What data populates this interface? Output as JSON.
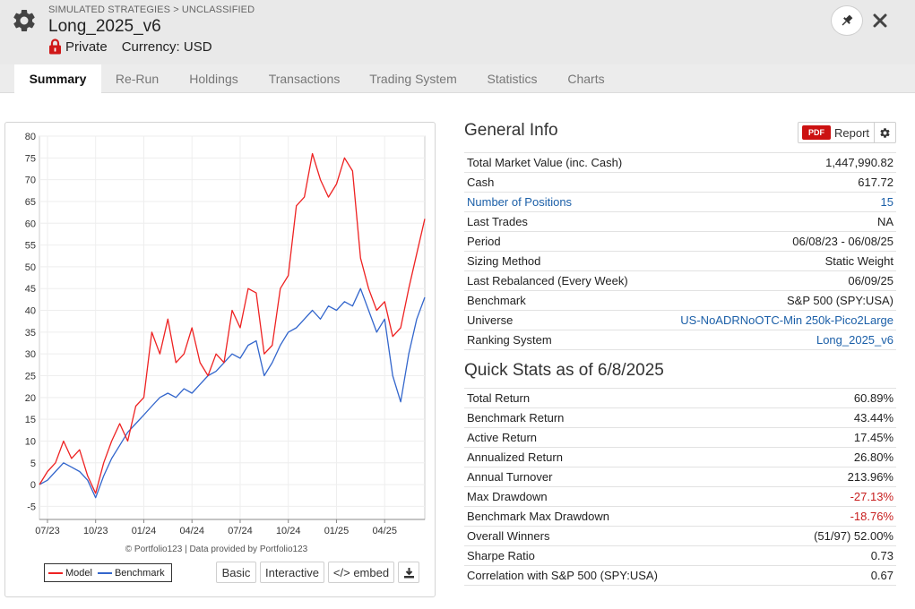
{
  "header": {
    "breadcrumb": "SIMULATED STRATEGIES > UNCLASSIFIED",
    "title": "Long_2025_v6",
    "privacy": "Private",
    "currency": "Currency: USD"
  },
  "tabs": [
    "Summary",
    "Re-Run",
    "Holdings",
    "Transactions",
    "Trading System",
    "Statistics",
    "Charts"
  ],
  "chart": {
    "credit": "© Portfolio123 | Data provided by Portfolio123",
    "legend": [
      "Model",
      "Benchmark"
    ],
    "buttons": {
      "basic": "Basic",
      "interactive": "Interactive",
      "embed": "</> embed"
    }
  },
  "general_info": {
    "title": "General Info",
    "report_label": "Report",
    "pdf_label": "PDF",
    "rows": [
      {
        "label": "Total Market Value (inc. Cash)",
        "value": "1,447,990.82"
      },
      {
        "label": "Cash",
        "value": "617.72"
      },
      {
        "label": "Number of Positions",
        "value": "15"
      },
      {
        "label": "Last Trades",
        "value": "NA"
      },
      {
        "label": "Period",
        "value": "06/08/23 - 06/08/25"
      },
      {
        "label": "Sizing Method",
        "value": "Static Weight"
      },
      {
        "label": "Last Rebalanced (Every Week)",
        "value": "06/09/25"
      },
      {
        "label": "Benchmark",
        "value": "S&P 500 (SPY:USA)"
      },
      {
        "label": "Universe",
        "value": "US-NoADRNoOTC-Min 250k-Pico2Large"
      },
      {
        "label": "Ranking System",
        "value": "Long_2025_v6"
      }
    ]
  },
  "quick_stats": {
    "title": "Quick Stats as of 6/8/2025",
    "rows": [
      {
        "label": "Total Return",
        "value": "60.89%"
      },
      {
        "label": "Benchmark Return",
        "value": "43.44%"
      },
      {
        "label": "Active Return",
        "value": "17.45%"
      },
      {
        "label": "Annualized Return",
        "value": "26.80%"
      },
      {
        "label": "Annual Turnover",
        "value": "213.96%"
      },
      {
        "label": "Max Drawdown",
        "value": "-27.13%"
      },
      {
        "label": "Benchmark Max Drawdown",
        "value": "-18.76%"
      },
      {
        "label": "Overall Winners",
        "value": "(51/97) 52.00%"
      },
      {
        "label": "Sharpe Ratio",
        "value": "0.73"
      },
      {
        "label": "Correlation with S&P 500 (SPY:USA)",
        "value": "0.67"
      }
    ]
  },
  "colors": {
    "model": "#ee2222",
    "benchmark": "#3366cc",
    "negative": "#c81e1e",
    "link": "#1b5fa8",
    "pdf": "#cc1111"
  },
  "chart_data": {
    "type": "line",
    "ylim": [
      -8,
      80
    ],
    "yticks": [
      -5,
      0,
      5,
      10,
      15,
      20,
      25,
      30,
      35,
      40,
      45,
      50,
      55,
      60,
      65,
      70,
      75,
      80
    ],
    "xticks": [
      "07/23",
      "10/23",
      "01/24",
      "04/24",
      "07/24",
      "10/24",
      "01/25",
      "04/25"
    ],
    "x_tick_positions": [
      0.5,
      3.5,
      6.5,
      9.5,
      12.5,
      15.5,
      18.5,
      21.5
    ],
    "x_range": [
      0,
      24
    ],
    "series": [
      {
        "name": "Model",
        "x": [
          0,
          0.5,
          1,
          1.5,
          2,
          2.5,
          3,
          3.5,
          4,
          4.5,
          5,
          5.5,
          6,
          6.5,
          7,
          7.5,
          8,
          8.5,
          9,
          9.5,
          10,
          10.5,
          11,
          11.5,
          12,
          12.5,
          13,
          13.5,
          14,
          14.5,
          15,
          15.5,
          16,
          16.5,
          17,
          17.5,
          18,
          18.5,
          19,
          19.5,
          20,
          20.5,
          21,
          21.5,
          22,
          22.5,
          23,
          23.5,
          24
        ],
        "values": [
          0,
          3,
          5,
          10,
          6,
          8,
          2,
          -2,
          5,
          10,
          14,
          10,
          18,
          20,
          35,
          30,
          38,
          28,
          30,
          36,
          28,
          25,
          30,
          28,
          40,
          36,
          45,
          44,
          30,
          32,
          45,
          48,
          64,
          66,
          76,
          70,
          66,
          69,
          75,
          72,
          52,
          45,
          40,
          42,
          34,
          36,
          45,
          53,
          61
        ]
      },
      {
        "name": "Benchmark",
        "x": [
          0,
          0.5,
          1,
          1.5,
          2,
          2.5,
          3,
          3.5,
          4,
          4.5,
          5,
          5.5,
          6,
          6.5,
          7,
          7.5,
          8,
          8.5,
          9,
          9.5,
          10,
          10.5,
          11,
          11.5,
          12,
          12.5,
          13,
          13.5,
          14,
          14.5,
          15,
          15.5,
          16,
          16.5,
          17,
          17.5,
          18,
          18.5,
          19,
          19.5,
          20,
          20.5,
          21,
          21.5,
          22,
          22.5,
          23,
          23.5,
          24
        ],
        "values": [
          0,
          1,
          3,
          5,
          4,
          3,
          1,
          -3,
          2,
          6,
          9,
          12,
          14,
          16,
          18,
          20,
          21,
          20,
          22,
          21,
          23,
          25,
          26,
          28,
          30,
          29,
          32,
          33,
          25,
          28,
          32,
          35,
          36,
          38,
          40,
          38,
          41,
          40,
          42,
          41,
          45,
          40,
          35,
          38,
          25,
          19,
          30,
          38,
          43
        ]
      }
    ]
  }
}
